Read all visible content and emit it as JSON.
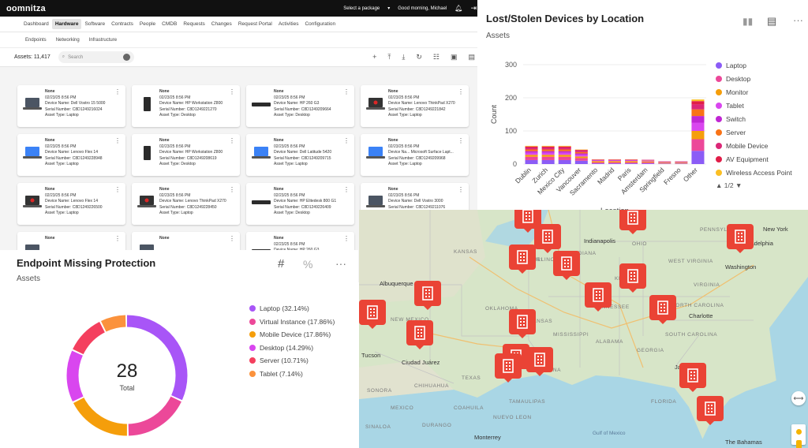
{
  "app": {
    "logo": "oomnitza",
    "package_label": "Select a package",
    "greeting": "Good morning, Michael",
    "nav": [
      "Dashboard",
      "Hardware",
      "Software",
      "Contracts",
      "People",
      "CMDB",
      "Requests",
      "Changes",
      "Request Portal",
      "Activities",
      "Configuration"
    ],
    "active_nav": 1,
    "subnav": [
      "Endpoints",
      "Networking",
      "Infrastructure"
    ],
    "assets_count": "Assets: 11,417",
    "search_placeholder": "Search",
    "devices": [
      {
        "icon": "laptop",
        "name": "None",
        "date": "02/23/25 8:56 PM",
        "device": "Device Name: Dell Vostro 15 5000",
        "serial": "Serial Number: C8D1249216024",
        "type": "Asset Type: Laptop"
      },
      {
        "icon": "tower",
        "name": "None",
        "date": "02/23/25 8:56 PM",
        "device": "Device Name: HP Workstation Z800",
        "serial": "Serial Number: C8D1249221270",
        "type": "Asset Type: Desktop"
      },
      {
        "icon": "flat",
        "name": "None",
        "date": "02/23/25 8:56 PM",
        "device": "Device Name: HP 260 G3",
        "serial": "Serial Number: C8D1249209664",
        "type": "Asset Type: Desktop"
      },
      {
        "icon": "laptop-red",
        "name": "None",
        "date": "02/23/25 8:56 PM",
        "device": "Device Name: Lenovo ThinkPad X270",
        "serial": "Serial Number: C8D1249221842",
        "type": "Asset Type: Laptop"
      },
      {
        "icon": "laptop-blue",
        "name": "None",
        "date": "02/23/25 8:56 PM",
        "device": "Device Name: Lenovo Flex 14",
        "serial": "Serial Number: C8D1249228948",
        "type": "Asset Type: Laptop"
      },
      {
        "icon": "tower",
        "name": "None",
        "date": "02/23/25 8:56 PM",
        "device": "Device Name: HP Workstation Z800",
        "serial": "Serial Number: C8D1249208619",
        "type": "Asset Type: Desktop"
      },
      {
        "icon": "laptop-blue",
        "name": "None",
        "date": "02/23/25 8:56 PM",
        "device": "Device Name: Dell Latitude 5420",
        "serial": "Serial Number: C8D1249209715",
        "type": "Asset Type: Laptop"
      },
      {
        "icon": "laptop-blue",
        "name": "None",
        "date": "02/23/25 8:56 PM",
        "device": "Device Na... Microsoft Surface Lapt...",
        "serial": "Serial Number: C8D1249209968",
        "type": "Asset Type: Laptop"
      },
      {
        "icon": "laptop-red",
        "name": "None",
        "date": "02/23/25 8:56 PM",
        "device": "Device Name: Lenovo Flex 14",
        "serial": "Serial Number: C8D1249226500",
        "type": "Asset Type: Laptop"
      },
      {
        "icon": "laptop-red",
        "name": "None",
        "date": "02/23/25 8:56 PM",
        "device": "Device Name: Lenovo ThinkPad X270",
        "serial": "Serial Number: C8D1249228450",
        "type": "Asset Type: Laptop"
      },
      {
        "icon": "flat",
        "name": "None",
        "date": "02/23/25 8:56 PM",
        "device": "Device Name: HP Elitedesk 800 G1",
        "serial": "Serial Number: C8D1249226409",
        "type": "Asset Type: Desktop"
      },
      {
        "icon": "laptop",
        "name": "None",
        "date": "02/23/25 8:56 PM",
        "device": "Device Name: Dell Vostro 3000",
        "serial": "Serial Number: C8D1249211076",
        "type": "Asset Type: Laptop"
      },
      {
        "icon": "laptop",
        "name": "None",
        "date": "",
        "device": "",
        "serial": "",
        "type": ""
      },
      {
        "icon": "laptop",
        "name": "None",
        "date": "",
        "device": "",
        "serial": "",
        "type": ""
      },
      {
        "icon": "flat",
        "name": "None",
        "date": "02/23/25 8:56 PM",
        "device": "Device Name: HP 260 G3",
        "serial": "Serial Number: C8D1249213308",
        "type": "Asset Type: Desktop"
      },
      {
        "icon": "laptop",
        "name": "None",
        "date": "",
        "device": "",
        "serial": "",
        "type": ""
      }
    ]
  },
  "lost_chart": {
    "title": "Lost/Stolen Devices by Location",
    "subtitle": "Assets",
    "pager": "1/2",
    "colors": {
      "Laptop": "#8b5cf6",
      "Desktop": "#ec4899",
      "Monitor": "#f59e0b",
      "Tablet": "#d946ef",
      "Switch": "#c026d3",
      "Server": "#f97316",
      "Mobile Device": "#db2777",
      "AV Equipment": "#e11d48",
      "Wireless Access Point": "#fbbf24"
    }
  },
  "chart_data": {
    "type": "bar",
    "stacked": true,
    "categories": [
      "Dublin",
      "Zurich",
      "Mexico City",
      "Vancouver",
      "Sacramento",
      "Madrid",
      "Paris",
      "Amsterdam",
      "Springfield",
      "Fresno",
      "Other"
    ],
    "series": [
      {
        "name": "Laptop",
        "values": [
          12,
          12,
          12,
          10,
          2,
          2,
          2,
          2,
          1,
          1,
          40
        ]
      },
      {
        "name": "Desktop",
        "values": [
          10,
          10,
          10,
          8,
          3,
          3,
          3,
          3,
          1,
          1,
          35
        ]
      },
      {
        "name": "Monitor",
        "values": [
          6,
          6,
          6,
          5,
          4,
          4,
          4,
          3,
          2,
          2,
          25
        ]
      },
      {
        "name": "Tablet",
        "values": [
          6,
          6,
          6,
          5,
          2,
          2,
          2,
          2,
          1,
          1,
          25
        ]
      },
      {
        "name": "Switch",
        "values": [
          5,
          5,
          5,
          4,
          1,
          1,
          1,
          1,
          1,
          1,
          20
        ]
      },
      {
        "name": "Server",
        "values": [
          5,
          5,
          5,
          4,
          1,
          1,
          1,
          1,
          1,
          1,
          20
        ]
      },
      {
        "name": "Mobile Device",
        "values": [
          6,
          6,
          6,
          5,
          1,
          1,
          1,
          1,
          1,
          1,
          15
        ]
      },
      {
        "name": "AV Equipment",
        "values": [
          3,
          3,
          3,
          2,
          0,
          0,
          0,
          0,
          0,
          0,
          10
        ]
      },
      {
        "name": "Wireless Access Point",
        "values": [
          2,
          2,
          2,
          1,
          0,
          0,
          0,
          0,
          0,
          0,
          5
        ]
      }
    ],
    "xlabel": "Location",
    "ylabel": "Count",
    "ylim": [
      0,
      300
    ],
    "yticks": [
      0,
      100,
      200,
      300
    ],
    "grid": true,
    "legend": "right"
  },
  "donut": {
    "title": "Endpoint Missing Protection",
    "subtitle": "Assets",
    "total": "28",
    "total_label": "Total",
    "icons": {
      "hash": "#",
      "percent": "%",
      "more": "···"
    },
    "legend": [
      {
        "label": "Laptop (32.14%)",
        "color": "#a855f7",
        "value": 32.14
      },
      {
        "label": "Virtual Instance (17.86%)",
        "color": "#ec4899",
        "value": 17.86
      },
      {
        "label": "Mobile Device (17.86%)",
        "color": "#f59e0b",
        "value": 17.86
      },
      {
        "label": "Desktop (14.29%)",
        "color": "#d946ef",
        "value": 14.29
      },
      {
        "label": "Server (10.71%)",
        "color": "#f43f5e",
        "value": 10.71
      },
      {
        "label": "Tablet (7.14%)",
        "color": "#fb923c",
        "value": 7.14
      }
    ]
  },
  "map": {
    "cities": [
      "Indianapolis",
      "New York",
      "Washington",
      "Albuquerque",
      "Charlotte",
      "Tucson",
      "Ciudad Juárez",
      "Jacksonville",
      "Monterrey",
      "Gulf of Mexico",
      "The Bahamas",
      "Philadelphia"
    ],
    "states": [
      "ILLINOIS",
      "OHIO",
      "KENTUCKY",
      "TENNESSEE",
      "MISSISSIPPI",
      "ALABAMA",
      "GEORGIA",
      "LOUISIANA",
      "TEXAS",
      "OKLAHOMA",
      "ARKANSAS",
      "NEW MEXICO",
      "CHIHUAHUA",
      "COAHUILA",
      "FLORIDA",
      "SOUTH CAROLINA",
      "NORTH CAROLINA",
      "VIRGINIA",
      "WEST VIRGINIA",
      "PENNSYLVANIA",
      "MISSOURI",
      "KANSAS",
      "INDIANA",
      "DURANGO",
      "SINALOA",
      "NUEVO LEON",
      "TAMAULIPAS",
      "SONORA",
      "MEXICO"
    ]
  }
}
